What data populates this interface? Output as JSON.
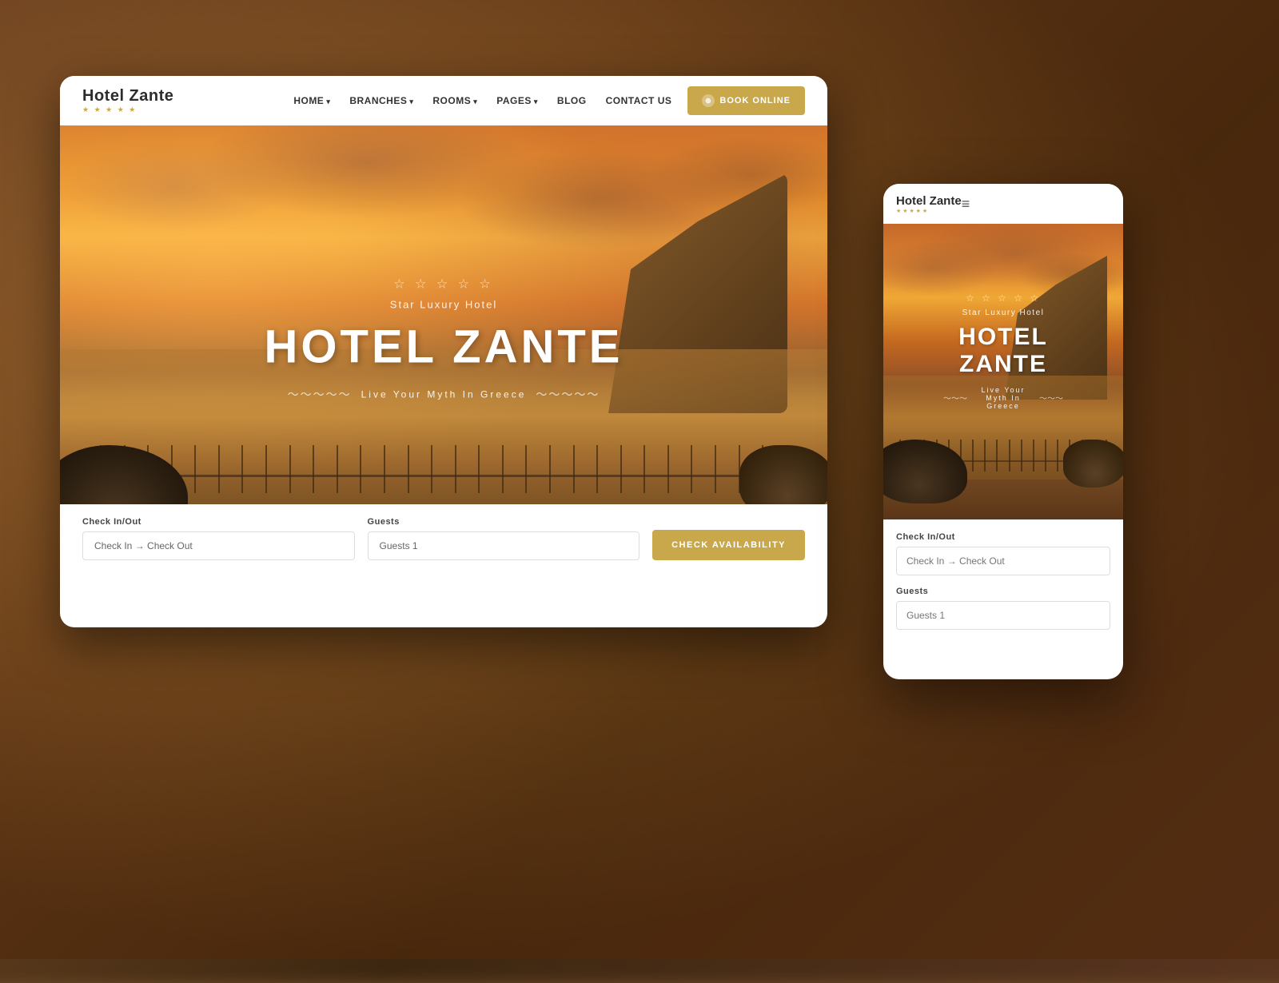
{
  "page": {
    "background": "blurred hotel scene",
    "title": "Hotel Zante"
  },
  "desktop": {
    "navbar": {
      "logo_name": "Hotel Zante",
      "logo_stars": "★ ★ ★ ★ ★",
      "nav_items": [
        {
          "label": "HOME",
          "has_dropdown": true
        },
        {
          "label": "BRANCHES",
          "has_dropdown": true
        },
        {
          "label": "ROOMS",
          "has_dropdown": true
        },
        {
          "label": "PAGES",
          "has_dropdown": true
        },
        {
          "label": "BLOG",
          "has_dropdown": false
        },
        {
          "label": "CONTACT US",
          "has_dropdown": false
        }
      ],
      "book_btn_label": "BOOK ONLINE"
    },
    "hero": {
      "stars": "☆ ☆ ☆ ☆ ☆",
      "subtitle": "Star Luxury Hotel",
      "title": "HOTEL ZANTE",
      "tagline": "Live Your Myth In Greece",
      "wave_left": "〜〜〜〜〜",
      "wave_right": "〜〜〜〜〜"
    },
    "booking": {
      "checkin_label": "Check In/Out",
      "checkin_placeholder": "Check In → Check Out",
      "guests_label": "Guests",
      "guests_placeholder": "Guests 1",
      "check_btn_label": "CHECK AVAILABILITY"
    }
  },
  "mobile": {
    "navbar": {
      "logo_name": "Hotel Zante",
      "logo_stars": "★ ★ ★ ★ ★",
      "hamburger_icon": "≡"
    },
    "hero": {
      "stars": "☆ ☆ ☆ ☆ ☆",
      "subtitle": "Star Luxury Hotel",
      "title": "HOTEL ZANTE",
      "tagline": "Live Your Myth In Greece",
      "wave_left": "〜〜〜",
      "wave_right": "〜〜〜"
    },
    "booking": {
      "checkin_label": "Check In/Out",
      "checkin_placeholder": "Check In → Check Out",
      "guests_label": "Guests",
      "guests_placeholder": "Guests 1"
    }
  }
}
